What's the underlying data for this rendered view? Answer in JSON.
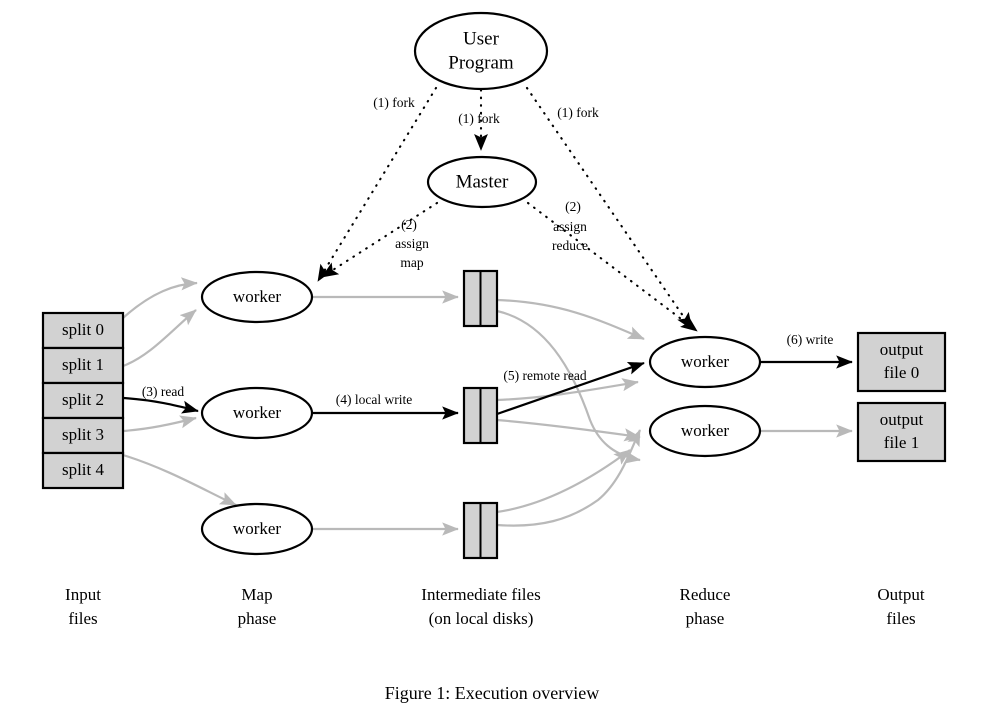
{
  "figure": {
    "caption": "Figure 1: Execution overview"
  },
  "nodes": {
    "user_program": {
      "line1": "User",
      "line2": "Program"
    },
    "master": {
      "label": "Master"
    },
    "map_workers": [
      {
        "label": "worker"
      },
      {
        "label": "worker"
      },
      {
        "label": "worker"
      }
    ],
    "reduce_workers": [
      {
        "label": "worker"
      },
      {
        "label": "worker"
      }
    ]
  },
  "input_files": {
    "splits": [
      {
        "label": "split 0"
      },
      {
        "label": "split 1"
      },
      {
        "label": "split 2"
      },
      {
        "label": "split 3"
      },
      {
        "label": "split 4"
      }
    ]
  },
  "intermediate_files": {
    "boxes": [
      {
        "label": ""
      },
      {
        "label": ""
      },
      {
        "label": ""
      }
    ]
  },
  "output_files": [
    {
      "line1": "output",
      "line2": "file 0"
    },
    {
      "line1": "output",
      "line2": "file 1"
    }
  ],
  "edge_labels": {
    "fork_left": "(1) fork",
    "fork_center": "(1) fork",
    "fork_right": "(1) fork",
    "assign_map_l1": "(2)",
    "assign_map_l2": "assign",
    "assign_map_l3": "map",
    "assign_reduce_l1": "(2)",
    "assign_reduce_l2": "assign",
    "assign_reduce_l3": "reduce",
    "read": "(3) read",
    "local_write": "(4) local write",
    "remote_read": "(5) remote read",
    "write": "(6) write"
  },
  "column_labels": [
    {
      "line1": "Input",
      "line2": "files"
    },
    {
      "line1": "Map",
      "line2": "phase"
    },
    {
      "line1": "Intermediate files",
      "line2": "(on local disks)"
    },
    {
      "line1": "Reduce",
      "line2": "phase"
    },
    {
      "line1": "Output",
      "line2": "files"
    }
  ],
  "colors": {
    "box_fill": "#d2d2d2",
    "stroke": "#000000",
    "faded_flow": "#b9b9b9",
    "background": "#ffffff"
  }
}
